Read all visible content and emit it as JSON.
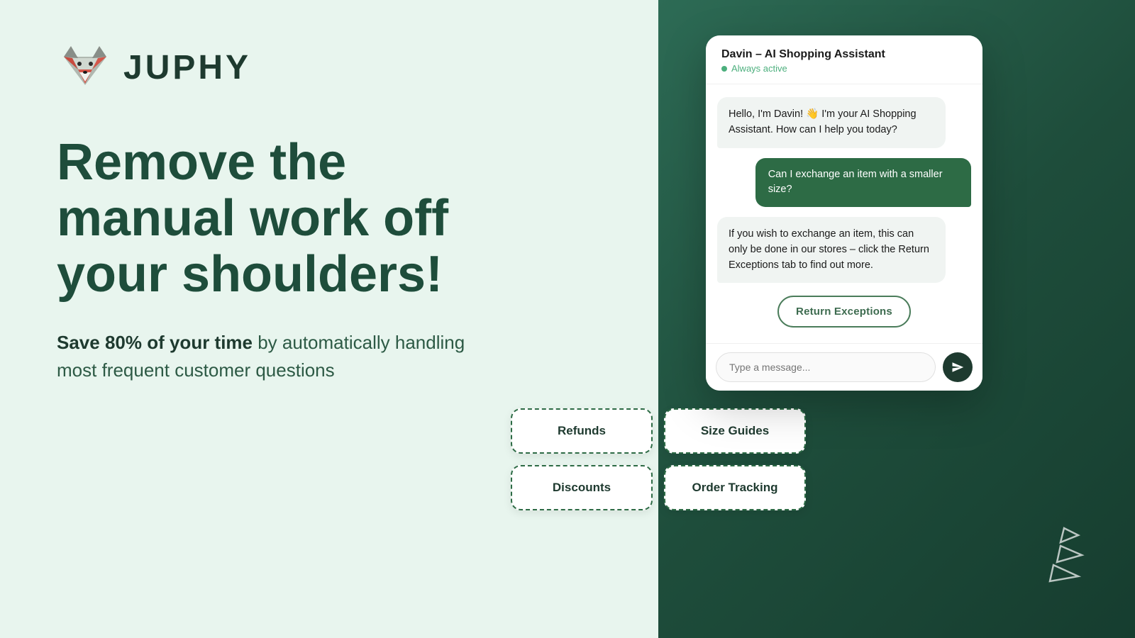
{
  "brand": {
    "name": "JUPHY",
    "logo_alt": "Juphy fox mascot logo"
  },
  "headline": {
    "line1": "Remove the",
    "line2": "manual work off",
    "line3": "your shoulders!"
  },
  "subtext": {
    "bold_part": "Save 80% of your time",
    "rest": " by automatically handling most frequent customer questions"
  },
  "chat": {
    "assistant_name": "Davin – AI Shopping Assistant",
    "status": "Always active",
    "messages": [
      {
        "type": "bot",
        "text": "Hello, I'm Davin! 👋 I'm your AI Shopping Assistant. How can I help you today?"
      },
      {
        "type": "user",
        "text": "Can I exchange an item with a smaller size?"
      },
      {
        "type": "bot",
        "text": "If you wish to exchange an item, this can only be done in our stores – click the Return Exceptions tab to find out more."
      }
    ],
    "return_exceptions_label": "Return Exceptions",
    "quick_actions": [
      {
        "label": "Refunds"
      },
      {
        "label": "Size Guides"
      },
      {
        "label": "Discounts"
      },
      {
        "label": "Order Tracking"
      }
    ],
    "input_placeholder": "Type a message...",
    "send_label": "Send"
  },
  "colors": {
    "brand_dark": "#1e4d3b",
    "brand_medium": "#2d6b45",
    "bg_left": "#e8f5ee",
    "bg_right": "#2d6b55",
    "status_green": "#4caf7d"
  }
}
